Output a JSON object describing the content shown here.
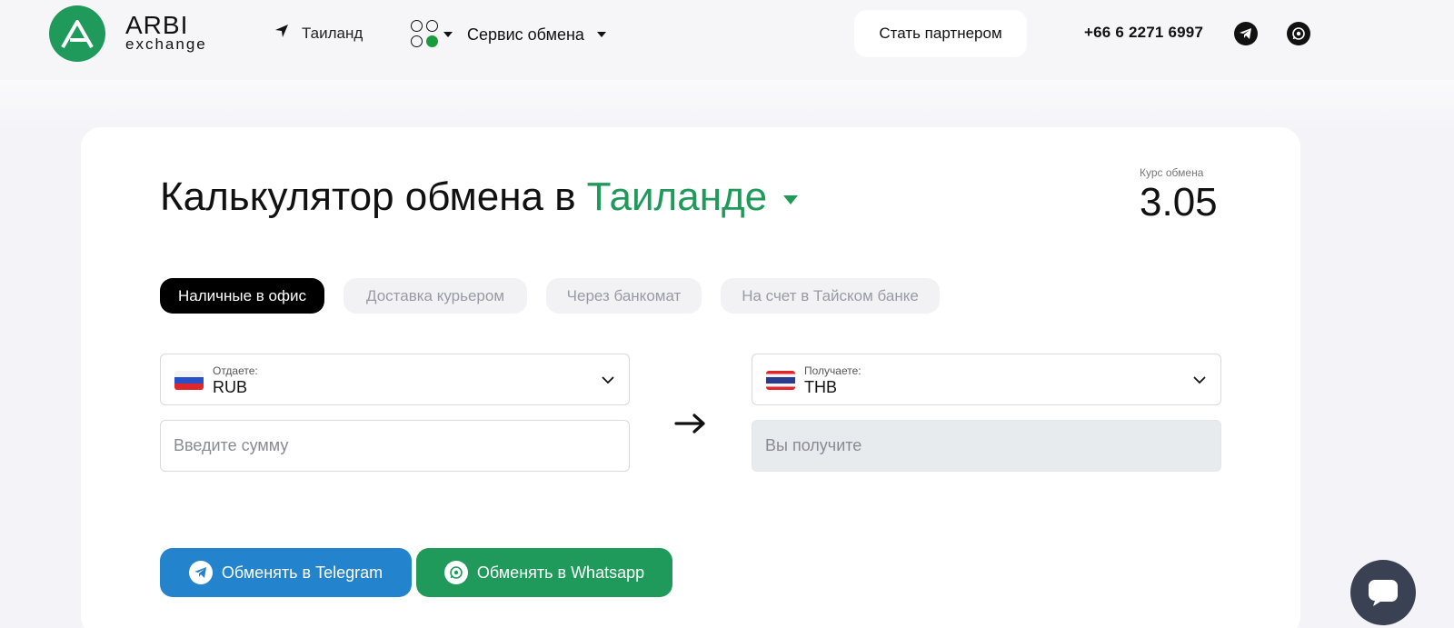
{
  "header": {
    "logo_line1": "ARBI",
    "logo_line2": "exchange",
    "location": "Таиланд",
    "service_label": "Сервис обмена",
    "partner_button": "Стать партнером",
    "phone": "+66 6 2271 6997",
    "icons": [
      "location-arrow-icon",
      "apps-icon",
      "telegram-icon",
      "whatsapp-icon"
    ]
  },
  "calculator": {
    "title_main": "Калькулятор обмена в",
    "title_accent": "Таиланде",
    "rate_label": "Курс обмена",
    "rate_value": "3.05",
    "tabs": [
      {
        "label": "Наличные в офис",
        "active": true
      },
      {
        "label": "Доставка курьером",
        "active": false
      },
      {
        "label": "Через банкомат",
        "active": false
      },
      {
        "label": "На счет в Тайском банке",
        "active": false
      }
    ],
    "give": {
      "label": "Отдаете:",
      "currency": "RUB",
      "placeholder": "Введите сумму"
    },
    "receive": {
      "label": "Получаете:",
      "currency": "THB",
      "placeholder": "Вы получите"
    },
    "buttons": {
      "telegram": "Обменять в Telegram",
      "whatsapp": "Обменять в Whatsapp"
    }
  },
  "colors": {
    "accent_green": "#1f9a5b",
    "telegram_blue": "#2383cc",
    "chat_bubble": "#3a4152"
  }
}
